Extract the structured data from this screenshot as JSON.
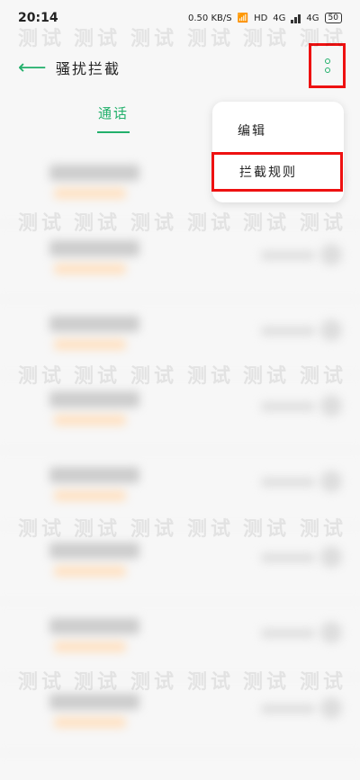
{
  "status_bar": {
    "time": "20:14",
    "speed": "0.50 KB/S",
    "hd": "HD",
    "network1": "4G",
    "network2": "4G",
    "battery": "50"
  },
  "header": {
    "back_icon": "arrow-left-icon",
    "title": "骚扰拦截",
    "more_icon": "more-vertical-icon"
  },
  "tabs": [
    {
      "label": "通话"
    }
  ],
  "menu": {
    "items": [
      {
        "label": "编辑"
      },
      {
        "label": "拦截规则"
      }
    ]
  },
  "watermark_text": "测试",
  "colors": {
    "accent": "#22b06b",
    "highlight_box": "#e11111"
  }
}
